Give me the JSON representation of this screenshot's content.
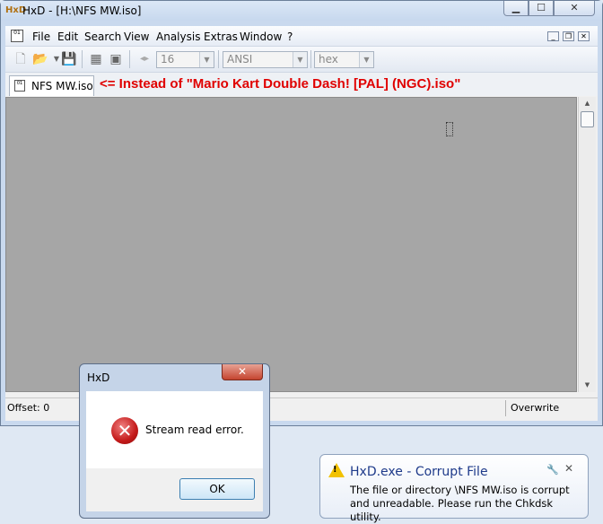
{
  "window": {
    "title": "HxD - [H:\\NFS MW.iso]"
  },
  "menu": {
    "items": [
      "File",
      "Edit",
      "Search",
      "View",
      "Analysis",
      "Extras",
      "Window",
      "?"
    ]
  },
  "toolbar": {
    "bytes_per_row": "16",
    "charset": "ANSI",
    "offset_base": "hex"
  },
  "tabs": [
    {
      "label": "NFS MW.iso"
    }
  ],
  "annotation": "<= Instead of \"Mario Kart Double Dash! [PAL] (NGC).iso\"",
  "statusbar": {
    "offset": "Offset: 0",
    "mode": "Overwrite"
  },
  "dialog": {
    "title": "HxD",
    "message": "Stream read error.",
    "ok_label": "OK"
  },
  "notification": {
    "title": "HxD.exe - Corrupt File",
    "message": "The file or directory \\NFS MW.iso is corrupt and unreadable. Please run the Chkdsk utility."
  },
  "colors": {
    "annotation": "#e00000",
    "editor_background": "#a6a6a6",
    "notification_title": "#1e3a8a"
  }
}
